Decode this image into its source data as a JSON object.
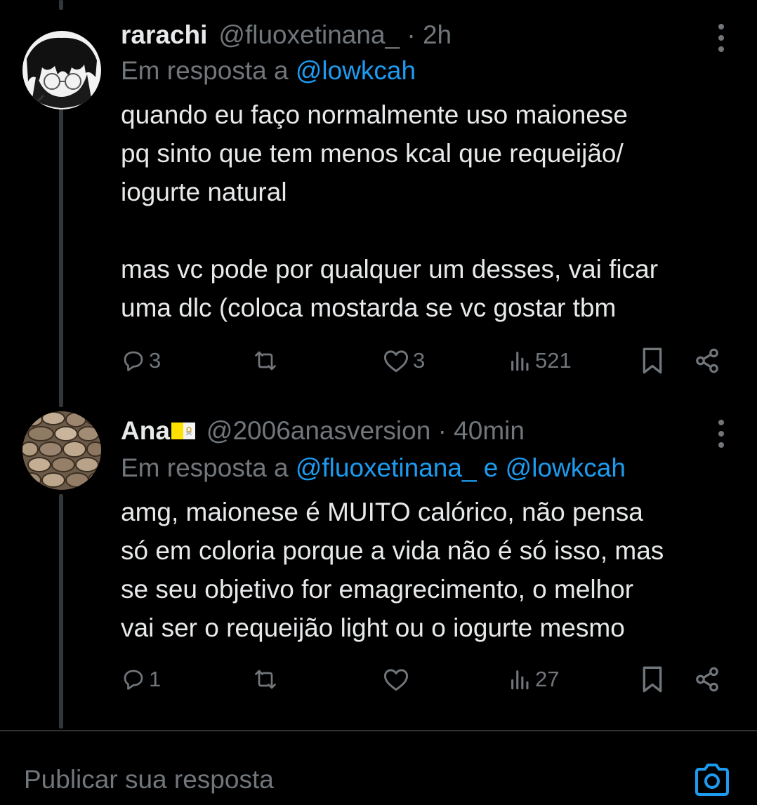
{
  "replies": [
    {
      "display_name": "rarachi",
      "handle_time": "@fluoxetinana_ · 2h",
      "reply_prefix": "Em resposta a",
      "reply_mentions": "@lowkcah",
      "text_lines_1": [
        "quando eu faço normalmente uso maionese",
        "pq sinto que tem menos kcal que requeijão/",
        "iogurte natural"
      ],
      "text_lines_2": [
        "mas vc pode por qualquer um desses, vai ficar",
        "uma dlc (coloca mostarda se vc gostar tbm"
      ],
      "replies_count": "3",
      "retweets_count": "",
      "likes_count": "3",
      "views_count": "521"
    },
    {
      "display_name": "Ana",
      "handle_time": "@2006anasversion · 40min",
      "reply_prefix": "Em resposta a",
      "reply_mentions": "@fluoxetinana_ e @lowkcah",
      "text_lines_1": [
        "amg, maionese é MUITO calórico, não pensa",
        "só em coloria porque a vida não é só isso, mas",
        "se seu objetivo for emagrecimento, o melhor",
        "vai ser o requeijão light ou o iogurte mesmo"
      ],
      "replies_count": "1",
      "retweets_count": "",
      "likes_count": "",
      "views_count": "27"
    }
  ],
  "composer": {
    "placeholder": "Publicar sua resposta"
  },
  "icons": {
    "reply": "reply-icon",
    "retweet": "retweet-icon",
    "like": "heart-icon",
    "views": "views-icon",
    "bookmark": "bookmark-icon",
    "share": "share-icon",
    "more": "more-dots-icon",
    "camera": "camera-icon",
    "flag": "vatican-flag-icon"
  },
  "colors": {
    "background": "#000000",
    "text": "#e7e9ea",
    "secondary": "#71767b",
    "accent": "#1d9bf0"
  }
}
